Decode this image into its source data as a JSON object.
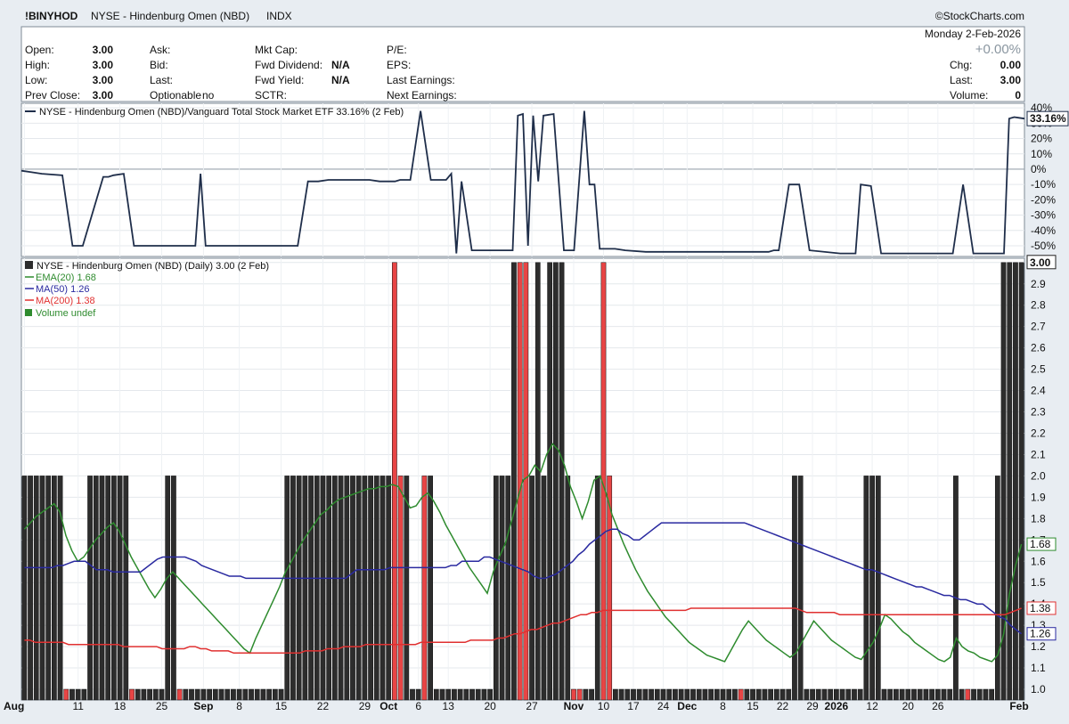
{
  "header": {
    "symbol": "!BINYHOD",
    "name": "NYSE - Hindenburg Omen (NBD)",
    "exchange": "INDX",
    "brand": "©StockCharts.com",
    "date": "Monday  2-Feb-2026",
    "pct_change": "+0.00%"
  },
  "quote": {
    "left": [
      {
        "label": "Open:",
        "value": "3.00"
      },
      {
        "label": "High:",
        "value": "3.00"
      },
      {
        "label": "Low:",
        "value": "3.00"
      },
      {
        "label": "Prev Close:",
        "value": "3.00"
      }
    ],
    "mid1": [
      {
        "label": "Ask:",
        "value": ""
      },
      {
        "label": "Bid:",
        "value": ""
      },
      {
        "label": "Last:",
        "value": ""
      },
      {
        "label": "Optionable",
        "value": "no"
      }
    ],
    "mid2": [
      {
        "label": "Mkt Cap:",
        "value": ""
      },
      {
        "label": "Fwd Dividend:",
        "value": "N/A"
      },
      {
        "label": "Fwd Yield:",
        "value": "N/A"
      },
      {
        "label": "SCTR:",
        "value": ""
      }
    ],
    "mid3": [
      {
        "label": "P/E:",
        "value": ""
      },
      {
        "label": "EPS:",
        "value": ""
      },
      {
        "label": "Last Earnings:",
        "value": ""
      },
      {
        "label": "Next Earnings:",
        "value": ""
      }
    ],
    "right": [
      {
        "label": "Chg:",
        "value": "0.00"
      },
      {
        "label": "Last:",
        "value": "3.00"
      },
      {
        "label": "Volume:",
        "value": "0"
      }
    ]
  },
  "chart_data": [
    {
      "type": "line",
      "title": "NYSE - Hindenburg Omen (NBD)/Vanguard Total Stock Market ETF 33.16% (2 Feb)",
      "ylabel": "",
      "ylim": [
        -57,
        43
      ],
      "yticks": [
        "40%",
        "30%",
        "20%",
        "10%",
        "0%",
        "-10%",
        "-20%",
        "-30%",
        "-40%",
        "-50%"
      ],
      "ytick_values": [
        40,
        30,
        20,
        10,
        0,
        -10,
        -20,
        -30,
        -40,
        -50
      ],
      "last_label": "33.16%",
      "x": [
        0,
        2,
        4,
        8,
        10,
        12,
        16,
        17,
        18,
        20,
        22,
        24,
        26,
        28,
        30,
        34,
        35,
        36,
        40,
        42,
        44,
        46,
        48,
        50,
        54,
        56,
        58,
        60,
        62,
        64,
        66,
        68,
        70,
        73,
        74,
        76,
        78,
        80,
        82,
        83,
        84,
        85,
        86,
        88,
        90,
        94,
        96,
        97,
        98,
        99,
        100,
        101,
        102,
        104,
        106,
        108,
        110,
        111,
        112,
        113,
        114,
        116,
        118,
        122,
        126,
        132,
        136,
        140,
        144,
        146,
        147,
        148,
        150,
        152,
        154,
        160,
        162,
        163,
        164,
        166,
        168,
        170,
        172,
        175,
        176,
        177,
        178,
        180,
        182,
        184,
        186,
        188,
        190,
        191,
        192,
        193,
        194,
        196
      ],
      "values": [
        -1,
        -2,
        -3,
        -4,
        -50,
        -50,
        -5,
        -5,
        -4,
        -3,
        -50,
        -50,
        -50,
        -50,
        -50,
        -50,
        -3,
        -50,
        -50,
        -50,
        -50,
        -50,
        -50,
        -50,
        -50,
        -8,
        -8,
        -7,
        -7,
        -7,
        -7,
        -7,
        -8,
        -8,
        -7,
        -7,
        38,
        -7,
        -7,
        -7,
        -3,
        -55,
        -8,
        -53,
        -53,
        -53,
        -53,
        35,
        36,
        -50,
        35,
        -8,
        35,
        36,
        -53,
        -53,
        38,
        -10,
        -10,
        -52,
        -52,
        -52,
        -53,
        -54,
        -54,
        -54,
        -54,
        -54,
        -54,
        -54,
        -53,
        -53,
        -10,
        -10,
        -53,
        -55,
        -55,
        -55,
        -10,
        -11,
        -55,
        -55,
        -55,
        -55,
        -55,
        -55,
        -55,
        -55,
        -55,
        -10,
        -55,
        -55,
        -55,
        -55,
        -55,
        33,
        34,
        33,
        33
      ],
      "color": "#1f2e4a"
    },
    {
      "type": "bar",
      "title": "NYSE - Hindenburg Omen (NBD) (Daily) 3.00 (2 Feb)",
      "ylim": [
        0.95,
        3.02
      ],
      "yticks": [
        "3.0",
        "2.9",
        "2.8",
        "2.7",
        "2.6",
        "2.5",
        "2.4",
        "2.3",
        "2.2",
        "2.1",
        "2.0",
        "1.9",
        "1.8",
        "1.7",
        "1.6",
        "1.5",
        "1.4",
        "1.3",
        "1.2",
        "1.1",
        "1.0"
      ],
      "ytick_values": [
        3.0,
        2.9,
        2.8,
        2.7,
        2.6,
        2.5,
        2.4,
        2.3,
        2.2,
        2.1,
        2.0,
        1.9,
        1.8,
        1.7,
        1.6,
        1.5,
        1.4,
        1.3,
        1.2,
        1.1,
        1.0
      ],
      "last_label": "3.00",
      "bar_values": [
        2,
        2,
        2,
        2,
        2,
        2,
        2,
        1,
        1,
        1,
        1,
        2,
        2,
        2,
        2,
        2,
        2,
        2,
        1,
        1,
        1,
        1,
        1,
        1,
        2,
        2,
        1,
        1,
        1,
        1,
        1,
        1,
        1,
        1,
        1,
        1,
        1,
        1,
        1,
        1,
        1,
        1,
        1,
        1,
        2,
        2,
        2,
        2,
        2,
        2,
        2,
        2,
        2,
        2,
        2,
        2,
        2,
        2,
        2,
        2,
        2,
        2,
        3,
        2,
        2,
        1,
        1,
        2,
        2,
        1,
        1,
        1,
        1,
        1,
        1,
        1,
        1,
        1,
        1,
        2,
        2,
        2,
        3,
        3,
        3,
        2,
        3,
        2,
        3,
        3,
        3,
        2,
        1,
        1,
        1,
        1,
        2,
        3,
        2,
        1,
        1,
        1,
        1,
        1,
        1,
        1,
        1,
        1,
        1,
        1,
        1,
        1,
        1,
        1,
        1,
        1,
        1,
        1,
        1,
        1,
        1,
        1,
        1,
        1,
        1,
        1,
        1,
        1,
        1,
        2,
        2,
        1,
        1,
        1,
        1,
        1,
        1,
        1,
        1,
        1,
        1,
        2,
        2,
        2,
        1,
        1,
        1,
        1,
        1,
        1,
        1,
        1,
        1,
        1,
        1,
        1,
        2,
        1,
        1,
        1,
        1,
        1,
        1,
        2,
        3,
        3,
        3,
        3
      ],
      "red_indices": [
        7,
        18,
        26,
        62,
        63,
        67,
        83,
        84,
        92,
        93,
        97,
        98,
        120,
        158
      ],
      "bar_color": "#2d2d2d",
      "red_color": "#e84545",
      "x_labels": [
        "Aug",
        "11",
        "18",
        "25",
        "Sep",
        "8",
        "15",
        "22",
        "29",
        "Oct",
        "6",
        "13",
        "20",
        "27",
        "Nov",
        "10",
        "17",
        "24",
        "Dec",
        "8",
        "15",
        "22",
        "29",
        "2026",
        "12",
        "20",
        "26",
        "Feb"
      ],
      "x_label_bold": [
        "Aug",
        "Sep",
        "Oct",
        "Nov",
        "Dec",
        "2026",
        "Feb"
      ],
      "x_label_bars": [
        0,
        9,
        16,
        23,
        30,
        36,
        43,
        50,
        57,
        61,
        66,
        71,
        78,
        85,
        92,
        97,
        102,
        107,
        111,
        117,
        122,
        127,
        132,
        136,
        142,
        148,
        153,
        159
      ],
      "series": [
        {
          "name": "EMA(20) 1.68",
          "color": "#2e8b2e",
          "last": "1.68",
          "values": [
            1.75,
            1.78,
            1.81,
            1.83,
            1.85,
            1.87,
            1.83,
            1.72,
            1.65,
            1.6,
            1.62,
            1.66,
            1.7,
            1.73,
            1.76,
            1.78,
            1.74,
            1.68,
            1.62,
            1.57,
            1.52,
            1.47,
            1.43,
            1.47,
            1.52,
            1.55,
            1.52,
            1.49,
            1.46,
            1.43,
            1.4,
            1.37,
            1.34,
            1.31,
            1.28,
            1.25,
            1.22,
            1.19,
            1.17,
            1.24,
            1.3,
            1.36,
            1.42,
            1.48,
            1.55,
            1.6,
            1.65,
            1.7,
            1.74,
            1.78,
            1.82,
            1.84,
            1.87,
            1.89,
            1.9,
            1.91,
            1.92,
            1.93,
            1.94,
            1.94,
            1.95,
            1.95,
            1.96,
            1.95,
            1.9,
            1.85,
            1.86,
            1.9,
            1.92,
            1.88,
            1.83,
            1.77,
            1.72,
            1.67,
            1.62,
            1.57,
            1.53,
            1.49,
            1.45,
            1.55,
            1.62,
            1.68,
            1.78,
            1.88,
            1.98,
            2.0,
            2.05,
            2.02,
            2.1,
            2.15,
            2.12,
            2.05,
            1.95,
            1.88,
            1.8,
            1.88,
            1.98,
            2.0,
            1.92,
            1.82,
            1.75,
            1.68,
            1.62,
            1.56,
            1.51,
            1.46,
            1.42,
            1.38,
            1.34,
            1.31,
            1.28,
            1.25,
            1.22,
            1.2,
            1.18,
            1.16,
            1.15,
            1.14,
            1.13,
            1.18,
            1.23,
            1.28,
            1.32,
            1.29,
            1.26,
            1.23,
            1.21,
            1.19,
            1.17,
            1.15,
            1.17,
            1.22,
            1.27,
            1.32,
            1.29,
            1.26,
            1.23,
            1.21,
            1.19,
            1.17,
            1.15,
            1.14,
            1.18,
            1.22,
            1.28,
            1.35,
            1.33,
            1.3,
            1.27,
            1.25,
            1.22,
            1.2,
            1.18,
            1.16,
            1.14,
            1.13,
            1.15,
            1.24,
            1.2,
            1.18,
            1.17,
            1.15,
            1.14,
            1.13,
            1.16,
            1.26,
            1.45,
            1.58,
            1.68
          ]
        },
        {
          "name": "MA(50) 1.26",
          "color": "#2a2aa0",
          "last": "1.26",
          "values": [
            1.57,
            1.57,
            1.57,
            1.57,
            1.57,
            1.57,
            1.58,
            1.58,
            1.59,
            1.6,
            1.6,
            1.6,
            1.58,
            1.56,
            1.56,
            1.56,
            1.55,
            1.55,
            1.55,
            1.55,
            1.55,
            1.55,
            1.57,
            1.59,
            1.61,
            1.62,
            1.62,
            1.62,
            1.62,
            1.62,
            1.61,
            1.6,
            1.58,
            1.57,
            1.56,
            1.55,
            1.54,
            1.53,
            1.53,
            1.53,
            1.52,
            1.52,
            1.52,
            1.52,
            1.52,
            1.52,
            1.52,
            1.52,
            1.52,
            1.52,
            1.52,
            1.52,
            1.52,
            1.52,
            1.52,
            1.52,
            1.52,
            1.52,
            1.52,
            1.54,
            1.56,
            1.56,
            1.56,
            1.56,
            1.56,
            1.56,
            1.57,
            1.57,
            1.57,
            1.57,
            1.57,
            1.57,
            1.57,
            1.57,
            1.57,
            1.57,
            1.57,
            1.58,
            1.58,
            1.6,
            1.6,
            1.6,
            1.6,
            1.62,
            1.62,
            1.61,
            1.6,
            1.59,
            1.58,
            1.57,
            1.56,
            1.55,
            1.53,
            1.52,
            1.52,
            1.53,
            1.54,
            1.56,
            1.58,
            1.6,
            1.63,
            1.65,
            1.68,
            1.7,
            1.72,
            1.74,
            1.75,
            1.75,
            1.73,
            1.72,
            1.7,
            1.7,
            1.72,
            1.74,
            1.76,
            1.78,
            1.78,
            1.78,
            1.78,
            1.78,
            1.78,
            1.78,
            1.78,
            1.78,
            1.78,
            1.78,
            1.78,
            1.78,
            1.78,
            1.78,
            1.78,
            1.77,
            1.76,
            1.75,
            1.74,
            1.73,
            1.72,
            1.71,
            1.7,
            1.69,
            1.68,
            1.67,
            1.66,
            1.65,
            1.64,
            1.63,
            1.62,
            1.61,
            1.6,
            1.59,
            1.58,
            1.57,
            1.56,
            1.56,
            1.55,
            1.54,
            1.53,
            1.52,
            1.51,
            1.5,
            1.49,
            1.48,
            1.48,
            1.47,
            1.46,
            1.45,
            1.44,
            1.44,
            1.43,
            1.42,
            1.42,
            1.41,
            1.4,
            1.4,
            1.38,
            1.36,
            1.34,
            1.33,
            1.3,
            1.28,
            1.26
          ]
        },
        {
          "name": "MA(200) 1.38",
          "color": "#e03030",
          "last": "1.38",
          "values": [
            1.23,
            1.23,
            1.22,
            1.22,
            1.22,
            1.22,
            1.22,
            1.22,
            1.21,
            1.21,
            1.21,
            1.21,
            1.21,
            1.21,
            1.21,
            1.21,
            1.21,
            1.21,
            1.2,
            1.2,
            1.2,
            1.2,
            1.2,
            1.2,
            1.2,
            1.19,
            1.19,
            1.19,
            1.19,
            1.19,
            1.2,
            1.2,
            1.19,
            1.19,
            1.18,
            1.18,
            1.18,
            1.18,
            1.17,
            1.17,
            1.17,
            1.17,
            1.17,
            1.17,
            1.17,
            1.17,
            1.17,
            1.17,
            1.17,
            1.17,
            1.17,
            1.18,
            1.18,
            1.18,
            1.18,
            1.19,
            1.19,
            1.19,
            1.2,
            1.2,
            1.2,
            1.2,
            1.21,
            1.21,
            1.21,
            1.21,
            1.21,
            1.21,
            1.21,
            1.21,
            1.21,
            1.21,
            1.22,
            1.22,
            1.22,
            1.22,
            1.22,
            1.22,
            1.22,
            1.22,
            1.22,
            1.23,
            1.23,
            1.23,
            1.23,
            1.23,
            1.24,
            1.24,
            1.25,
            1.26,
            1.26,
            1.27,
            1.28,
            1.28,
            1.29,
            1.3,
            1.31,
            1.31,
            1.32,
            1.33,
            1.34,
            1.35,
            1.35,
            1.36,
            1.36,
            1.37,
            1.37,
            1.37,
            1.37,
            1.37,
            1.37,
            1.37,
            1.37,
            1.37,
            1.37,
            1.37,
            1.37,
            1.37,
            1.37,
            1.37,
            1.37,
            1.38,
            1.38,
            1.38,
            1.38,
            1.38,
            1.38,
            1.38,
            1.38,
            1.38,
            1.38,
            1.38,
            1.38,
            1.38,
            1.38,
            1.38,
            1.38,
            1.38,
            1.38,
            1.38,
            1.38,
            1.37,
            1.36,
            1.36,
            1.36,
            1.36,
            1.36,
            1.36,
            1.35,
            1.35,
            1.35,
            1.35,
            1.35,
            1.35,
            1.35,
            1.35,
            1.35,
            1.35,
            1.35,
            1.35,
            1.35,
            1.35,
            1.35,
            1.35,
            1.35,
            1.35,
            1.35,
            1.35,
            1.35,
            1.35,
            1.35,
            1.35,
            1.35,
            1.35,
            1.35,
            1.35,
            1.35,
            1.35,
            1.35,
            1.36,
            1.37,
            1.38
          ]
        }
      ],
      "legend_extra": "Volume undef"
    }
  ]
}
